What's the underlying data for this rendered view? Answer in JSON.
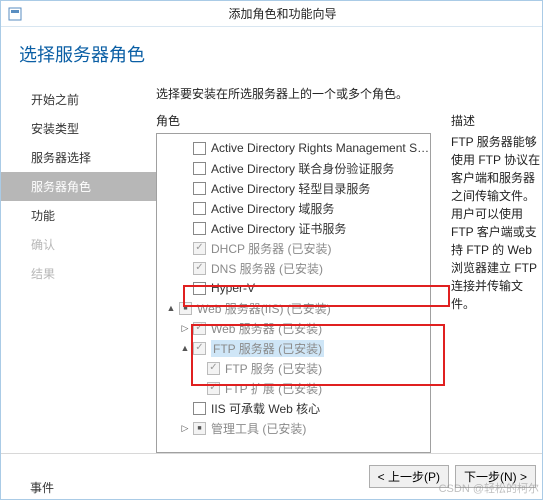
{
  "window": {
    "title": "添加角色和功能向导"
  },
  "header": "选择服务器角色",
  "sidebar": {
    "items": [
      {
        "label": "开始之前"
      },
      {
        "label": "安装类型"
      },
      {
        "label": "服务器选择"
      },
      {
        "label": "服务器角色"
      },
      {
        "label": "功能"
      },
      {
        "label": "确认"
      },
      {
        "label": "结果"
      }
    ]
  },
  "instruction": "选择要安装在所选服务器上的一个或多个角色。",
  "roles_header": "角色",
  "desc_header": "描述",
  "description": "FTP 服务器能够使用 FTP 协议在客户端和服务器之间传输文件。用户可以使用 FTP 客户端或支持 FTP 的 Web 浏览器建立 FTP 连接并传输文件。",
  "tree": [
    {
      "indent": 1,
      "label": "Active Directory Rights Management Services",
      "state": "unchecked"
    },
    {
      "indent": 1,
      "label": "Active Directory 联合身份验证服务",
      "state": "unchecked"
    },
    {
      "indent": 1,
      "label": "Active Directory 轻型目录服务",
      "state": "unchecked"
    },
    {
      "indent": 1,
      "label": "Active Directory 域服务",
      "state": "unchecked"
    },
    {
      "indent": 1,
      "label": "Active Directory 证书服务",
      "state": "unchecked"
    },
    {
      "indent": 1,
      "label": "DHCP 服务器 (已安装)",
      "state": "checked",
      "disabled": true
    },
    {
      "indent": 1,
      "label": "DNS 服务器 (已安装)",
      "state": "checked",
      "disabled": true
    },
    {
      "indent": 1,
      "label": "Hyper-V",
      "state": "unchecked"
    },
    {
      "indent": 0,
      "exp": "▲",
      "label": "Web 服务器(IIS) (已安装)",
      "state": "indet",
      "disabled": true
    },
    {
      "indent": 1,
      "exp": "▷",
      "label": "Web 服务器 (已安装)",
      "state": "checked",
      "disabled": true
    },
    {
      "indent": 1,
      "exp": "▲",
      "label": "FTP 服务器 (已安装)",
      "state": "checked",
      "disabled": true,
      "selected": true
    },
    {
      "indent": 2,
      "label": "FTP 服务 (已安装)",
      "state": "checked",
      "disabled": true
    },
    {
      "indent": 2,
      "label": "FTP 扩展 (已安装)",
      "state": "checked",
      "disabled": true
    },
    {
      "indent": 1,
      "label": "IIS 可承载 Web 核心",
      "state": "unchecked"
    },
    {
      "indent": 1,
      "exp": "▷",
      "label": "管理工具 (已安装)",
      "state": "indet",
      "disabled": true
    }
  ],
  "buttons": {
    "prev": "< 上一步(P)",
    "next": "下一步(N) >"
  },
  "extra_label": "事件",
  "watermark": "CSDN @轻松的柯尔"
}
